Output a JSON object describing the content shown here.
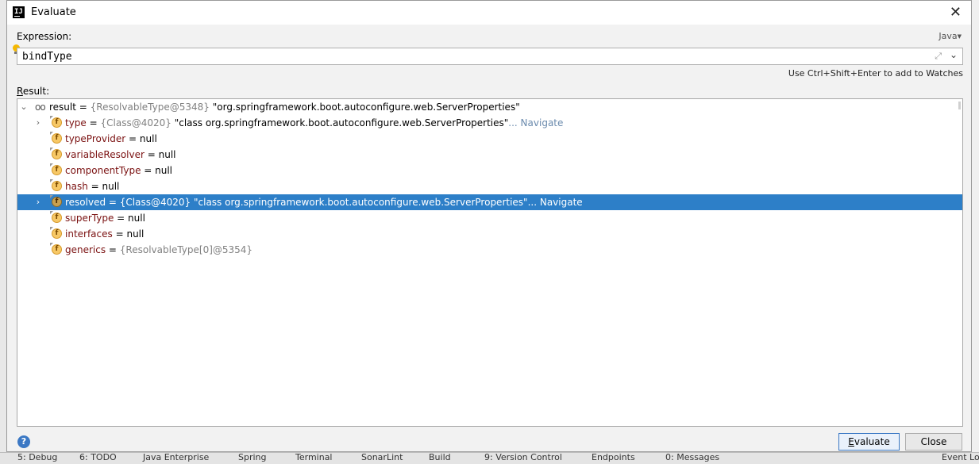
{
  "dialog": {
    "title": "Evaluate",
    "close_glyph": "✕"
  },
  "expression": {
    "label": "Expression:",
    "language": "Java",
    "value": "bindType",
    "hint": "Use Ctrl+Shift+Enter to add to Watches"
  },
  "result": {
    "label_first": "R",
    "label_rest": "esult:",
    "root": {
      "name": "result",
      "eq": " = ",
      "type_ref": "{ResolvableType@5348}",
      "value": " \"org.springframework.boot.autoconfigure.web.ServerProperties\""
    },
    "children": [
      {
        "name": "type",
        "eq": " = ",
        "type_ref": "{Class@4020}",
        "value": " \"class org.springframework.boot.autoconfigure.web.ServerProperties\"",
        "nav": "... Navigate",
        "expandable": true,
        "selected": false
      },
      {
        "name": "typeProvider",
        "eq": " = ",
        "type_ref": "",
        "value": "null",
        "nav": "",
        "expandable": false,
        "selected": false
      },
      {
        "name": "variableResolver",
        "eq": " = ",
        "type_ref": "",
        "value": "null",
        "nav": "",
        "expandable": false,
        "selected": false
      },
      {
        "name": "componentType",
        "eq": " = ",
        "type_ref": "",
        "value": "null",
        "nav": "",
        "expandable": false,
        "selected": false
      },
      {
        "name": "hash",
        "eq": " = ",
        "type_ref": "",
        "value": "null",
        "nav": "",
        "expandable": false,
        "selected": false
      },
      {
        "name": "resolved",
        "eq": " = ",
        "type_ref": "{Class@4020}",
        "value": " \"class org.springframework.boot.autoconfigure.web.ServerProperties\"",
        "nav": "... Navigate",
        "expandable": true,
        "selected": true
      },
      {
        "name": "superType",
        "eq": " = ",
        "type_ref": "",
        "value": "null",
        "nav": "",
        "expandable": false,
        "selected": false
      },
      {
        "name": "interfaces",
        "eq": " = ",
        "type_ref": "",
        "value": "null",
        "nav": "",
        "expandable": false,
        "selected": false
      },
      {
        "name": "generics",
        "eq": " = ",
        "type_ref": "{ResolvableType[0]@5354}",
        "value": "",
        "nav": "",
        "expandable": false,
        "selected": false
      }
    ]
  },
  "buttons": {
    "evaluate_first": "E",
    "evaluate_rest": "valuate",
    "close": "Close",
    "help": "?"
  },
  "taskbar": {
    "items": [
      "5: Debug",
      "6: TODO",
      "Java Enterprise",
      "Spring",
      "Terminal",
      "SonarLint",
      "Build",
      "9: Version Control",
      "Endpoints",
      "0: Messages",
      "Event Log"
    ]
  },
  "colors": {
    "selection": "#2d7fc8",
    "field_name": "#7a1010",
    "navigate_link": "#6a8aad",
    "type_ref": "#808080"
  },
  "icons": {
    "field": "field-icon",
    "watch": "watch-icon",
    "bulb": "intention-bulb-icon"
  }
}
